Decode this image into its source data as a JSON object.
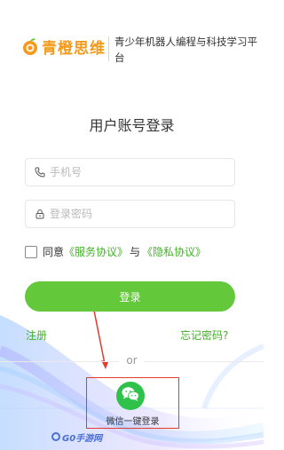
{
  "header": {
    "logo_text": "青橙思维",
    "tagline": "青少年机器人编程与科技学习平台"
  },
  "title": "用户账号登录",
  "form": {
    "phone_placeholder": "手机号",
    "password_placeholder": "登录密码"
  },
  "agreement": {
    "prefix": "同意",
    "service_link": "《服务协议》",
    "joiner": "与",
    "privacy_link": "《隐私协议》"
  },
  "login_button": "登录",
  "links": {
    "register": "注册",
    "forgot_password": "忘记密码?"
  },
  "divider_text": "or",
  "wechat": {
    "label": "微信一键登录"
  },
  "watermark": "G0手游网",
  "colors": {
    "brand_orange": "#f39a1b",
    "brand_green": "#63c83a",
    "link_green": "#43b02a",
    "wechat_green": "#2fc24b",
    "highlight_red": "#e33b2e"
  }
}
